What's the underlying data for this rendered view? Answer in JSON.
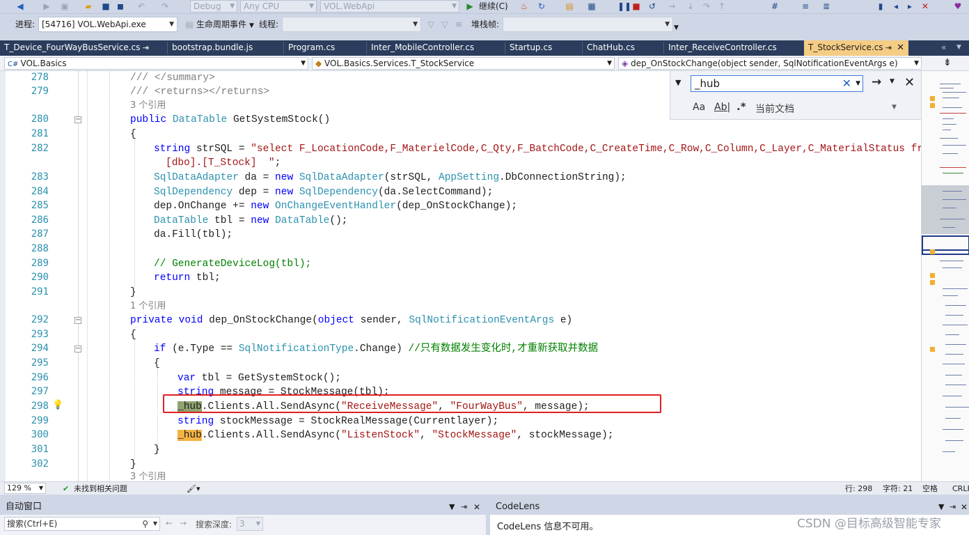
{
  "toolbar1": {
    "config_combo": "Debug",
    "platform_combo": "Any CPU",
    "project_combo": "VOL.WebApi",
    "continue_label": "继续(C)"
  },
  "toolbar2": {
    "process_label": "进程:",
    "process_value": "[54716] VOL.WebApi.exe",
    "lifecycle_label": "生命周期事件",
    "thread_label": "线程:",
    "stackframe_label": "堆栈帧:"
  },
  "tabs": [
    {
      "label": "T_Device_FourWayBusService.cs",
      "pin": "⇥"
    },
    {
      "label": "bootstrap.bundle.js"
    },
    {
      "label": "Program.cs"
    },
    {
      "label": "Inter_MobileController.cs"
    },
    {
      "label": "Startup.cs"
    },
    {
      "label": "ChatHub.cs"
    },
    {
      "label": "Inter_ReceiveController.cs"
    },
    {
      "label": "T_StockService.cs",
      "active": true
    }
  ],
  "nav": {
    "project": "VOL.Basics",
    "class": "VOL.Basics.Services.T_StockService",
    "member": "dep_OnStockChange(object sender, SqlNotificationEventArgs e)"
  },
  "find": {
    "query": "_hub",
    "match_case": "Aa",
    "whole_word": "Ab|",
    "regex": ".*",
    "scope": "当前文档"
  },
  "code": {
    "l278": "/// </summary>",
    "l279": "/// <returns></returns>",
    "ref1": "3 个引用",
    "l280_a": "public",
    "l280_b": "DataTable",
    "l280_c": "GetSystemStock()",
    "l281": "{",
    "l282_a": "string",
    "l282_b": " strSQL = ",
    "l282_c": "\"select F_LocationCode,F_MaterielCode,C_Qty,F_BatchCode,C_CreateTime,C_Row,C_Column,C_Layer,C_MaterialStatus from",
    "l282_d": "[dbo].[T_Stock]  \"",
    "l282_e": ";",
    "l283_a": "SqlDataAdapter",
    "l283_b": " da = ",
    "l283_c": "new",
    "l283_d": "SqlDataAdapter",
    "l283_e": "(strSQL, ",
    "l283_f": "AppSetting",
    "l283_g": ".DbConnectionString);",
    "l284_a": "SqlDependency",
    "l284_b": " dep = ",
    "l284_c": "new",
    "l284_d": "SqlDependency",
    "l284_e": "(da.SelectCommand);",
    "l285_a": "dep.OnChange += ",
    "l285_b": "new",
    "l285_c": "OnChangeEventHandler",
    "l285_d": "(dep_OnStockChange);",
    "l286_a": "DataTable",
    "l286_b": " tbl = ",
    "l286_c": "new",
    "l286_d": "DataTable",
    "l286_e": "();",
    "l287": "da.Fill(tbl);",
    "l289": "// GenerateDeviceLog(tbl);",
    "l290_a": "return",
    "l290_b": " tbl;",
    "l291": "}",
    "ref2": "1 个引用",
    "l292_a": "private",
    "l292_b": "void",
    "l292_c": " dep_OnStockChange(",
    "l292_d": "object",
    "l292_e": " sender, ",
    "l292_f": "SqlNotificationEventArgs",
    "l292_g": " e)",
    "l293": "{",
    "l294_a": "if",
    "l294_b": " (e.Type == ",
    "l294_c": "SqlNotificationType",
    "l294_d": ".Change) ",
    "l294_e": "//只有数据发生变化时,才重新获取并数据",
    "l295": "{",
    "l296_a": "var",
    "l296_b": " tbl = GetSystemStock();",
    "l297_a": "string",
    "l297_b": " message = StockMessage(tbl);",
    "l298_a": "_hub",
    "l298_b": ".Clients.All.SendAsync(",
    "l298_c": "\"ReceiveMessage\"",
    "l298_d": ", ",
    "l298_e": "\"FourWayBus\"",
    "l298_f": ", message);",
    "l299_a": "string",
    "l299_b": " stockMessage = StockRealMessage(Currentlayer);",
    "l300_a": "_hub",
    "l300_b": ".Clients.All.SendAsync(",
    "l300_c": "\"ListenStock\"",
    "l300_d": ", ",
    "l300_e": "\"StockMessage\"",
    "l300_f": ", stockMessage);",
    "l301": "}",
    "l302": "}",
    "ref3": "3 个引用"
  },
  "line_numbers": [
    "278",
    "279",
    "280",
    "281",
    "282",
    "283",
    "284",
    "285",
    "286",
    "287",
    "288",
    "289",
    "290",
    "291",
    "292",
    "293",
    "294",
    "295",
    "296",
    "297",
    "298",
    "299",
    "300",
    "301",
    "302"
  ],
  "status": {
    "zoom": "129 %",
    "issues": "未找到相关问题",
    "line": "行: 298",
    "col": "字符: 21",
    "spaces": "空格",
    "eol": "CRLF"
  },
  "bottom": {
    "autos_title": "自动窗口",
    "search_placeholder": "搜索(Ctrl+E)",
    "search_depth_label": "搜索深度:",
    "search_depth_value": "3",
    "codelens_title": "CodeLens",
    "codelens_msg": "CodeLens 信息不可用。"
  },
  "watermark": "CSDN @目标高级智能专家"
}
